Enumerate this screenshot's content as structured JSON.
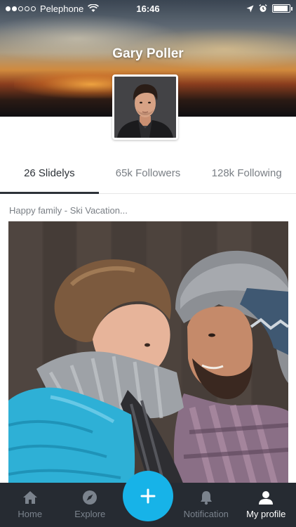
{
  "status_bar": {
    "carrier": "Pelephone",
    "time": "16:46",
    "signal_bars_filled": 2,
    "signal_bars_total": 5
  },
  "profile": {
    "name": "Gary Poller"
  },
  "stats": [
    {
      "label": "26 Slidelys",
      "active": true
    },
    {
      "label": "65k Followers",
      "active": false
    },
    {
      "label": "128k Following",
      "active": false
    }
  ],
  "post": {
    "title": "Happy family - Ski Vacation..."
  },
  "tab_bar": {
    "items": [
      {
        "label": "Home",
        "icon": "home-icon"
      },
      {
        "label": "Explore",
        "icon": "compass-icon"
      },
      {
        "label": "Notification",
        "icon": "bell-icon"
      },
      {
        "label": "My profile",
        "icon": "person-icon",
        "active": true
      }
    ],
    "add_icon": "plus-icon"
  },
  "colors": {
    "accent": "#17b3e8",
    "tab_bar_bg": "#262b32",
    "text_dark": "#2d3238",
    "text_muted": "#7a7f85"
  }
}
